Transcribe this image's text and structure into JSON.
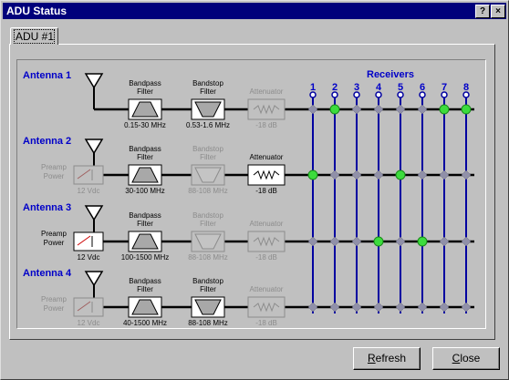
{
  "window": {
    "title": "ADU Status",
    "help_label": "?",
    "close_label": "×"
  },
  "tab": {
    "label": "ADU #1"
  },
  "receivers": {
    "title": "Receivers",
    "labels": [
      "1",
      "2",
      "3",
      "4",
      "5",
      "6",
      "7",
      "8"
    ]
  },
  "antennas": [
    {
      "label": "Antenna 1",
      "preamp": null,
      "bandpass": {
        "line1": "Bandpass",
        "line2": "Filter",
        "range": "0.15-30 MHz",
        "enabled": true
      },
      "bandstop": {
        "line1": "Bandstop",
        "line2": "Filter",
        "range": "0.53-1.6 MHz",
        "enabled": true
      },
      "attenuator": {
        "title": "Attenuator",
        "value": "-18 dB",
        "enabled": false
      },
      "connections": [
        false,
        true,
        false,
        false,
        false,
        false,
        true,
        true
      ]
    },
    {
      "label": "Antenna 2",
      "preamp": {
        "line1": "Preamp",
        "line2": "Power",
        "value": "12 Vdc",
        "enabled": false
      },
      "bandpass": {
        "line1": "Bandpass",
        "line2": "Filter",
        "range": "30-100 MHz",
        "enabled": true
      },
      "bandstop": {
        "line1": "Bandstop",
        "line2": "Filter",
        "range": "88-108 MHz",
        "enabled": false
      },
      "attenuator": {
        "title": "Attenuator",
        "value": "-18 dB",
        "enabled": true
      },
      "connections": [
        true,
        false,
        false,
        false,
        true,
        false,
        false,
        false
      ]
    },
    {
      "label": "Antenna 3",
      "preamp": {
        "line1": "Preamp",
        "line2": "Power",
        "value": "12 Vdc",
        "enabled": true
      },
      "bandpass": {
        "line1": "Bandpass",
        "line2": "Filter",
        "range": "100-1500 MHz",
        "enabled": true
      },
      "bandstop": {
        "line1": "Bandstop",
        "line2": "Filter",
        "range": "88-108 MHz",
        "enabled": false
      },
      "attenuator": {
        "title": "Attenuator",
        "value": "-18 dB",
        "enabled": false
      },
      "connections": [
        false,
        false,
        false,
        true,
        false,
        true,
        false,
        false
      ]
    },
    {
      "label": "Antenna 4",
      "preamp": {
        "line1": "Preamp",
        "line2": "Power",
        "value": "12 Vdc",
        "enabled": false
      },
      "bandpass": {
        "line1": "Bandpass",
        "line2": "Filter",
        "range": "40-1500 MHz",
        "enabled": true
      },
      "bandstop": {
        "line1": "Bandstop",
        "line2": "Filter",
        "range": "88-108 MHz",
        "enabled": true
      },
      "attenuator": {
        "title": "Attenuator",
        "value": "-18 dB",
        "enabled": false
      },
      "connections": [
        false,
        false,
        false,
        false,
        false,
        false,
        false,
        false
      ]
    }
  ],
  "buttons": {
    "refresh_label": "Refresh",
    "close_label": "Close"
  },
  "colors": {
    "title_bar": "#00007b",
    "accent_blue": "#0000c8",
    "receiver_line": "#0000a0",
    "active_node": "#3cdc3c",
    "inactive_node": "#9090a8",
    "disabled": "#8c8c8c"
  }
}
